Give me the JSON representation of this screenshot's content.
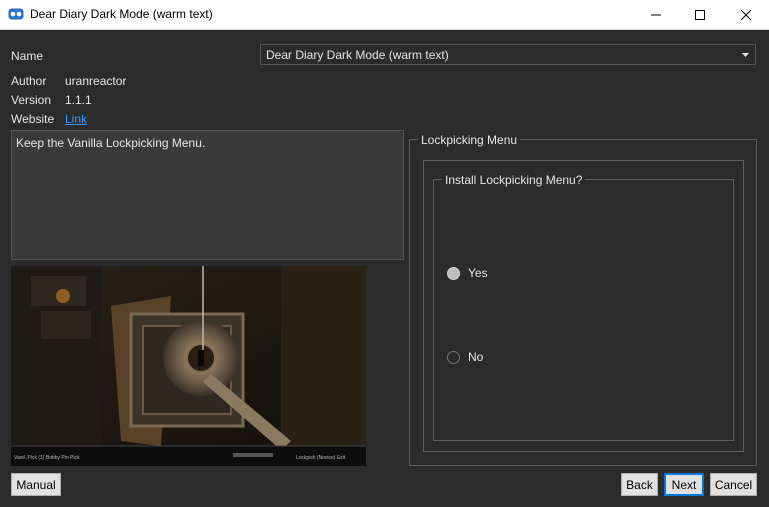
{
  "window": {
    "title": "Dear Diary Dark Mode (warm text)",
    "app_icon": "plugin-icon",
    "controls": [
      "minimize-icon",
      "maximize-icon",
      "close-icon"
    ]
  },
  "info": {
    "name_label": "Name",
    "name_value": "Dear Diary Dark Mode (warm text)",
    "author_label": "Author",
    "author_value": "uranreactor",
    "version_label": "Version",
    "version_value": "1.1.1",
    "website_label": "Website",
    "website_link": "Link"
  },
  "description": "Keep the Vanilla Lockpicking Menu.",
  "preview": {
    "hud_left": "Vanil..Pick  (1)  Bobby Pin  Pick",
    "hud_right": "Lockpick  (Novice) Exit"
  },
  "options": {
    "group_title": "Lockpicking Menu",
    "subgroup_title": "Install Lockpicking Menu?",
    "choices": [
      {
        "label": "Yes",
        "checked": true
      },
      {
        "label": "No",
        "checked": false
      }
    ]
  },
  "buttons": {
    "manual": "Manual",
    "back": "Back",
    "next": "Next",
    "cancel": "Cancel"
  },
  "colors": {
    "background": "#2b2b2b",
    "link": "#3399ff",
    "accent": "#0078d7"
  }
}
